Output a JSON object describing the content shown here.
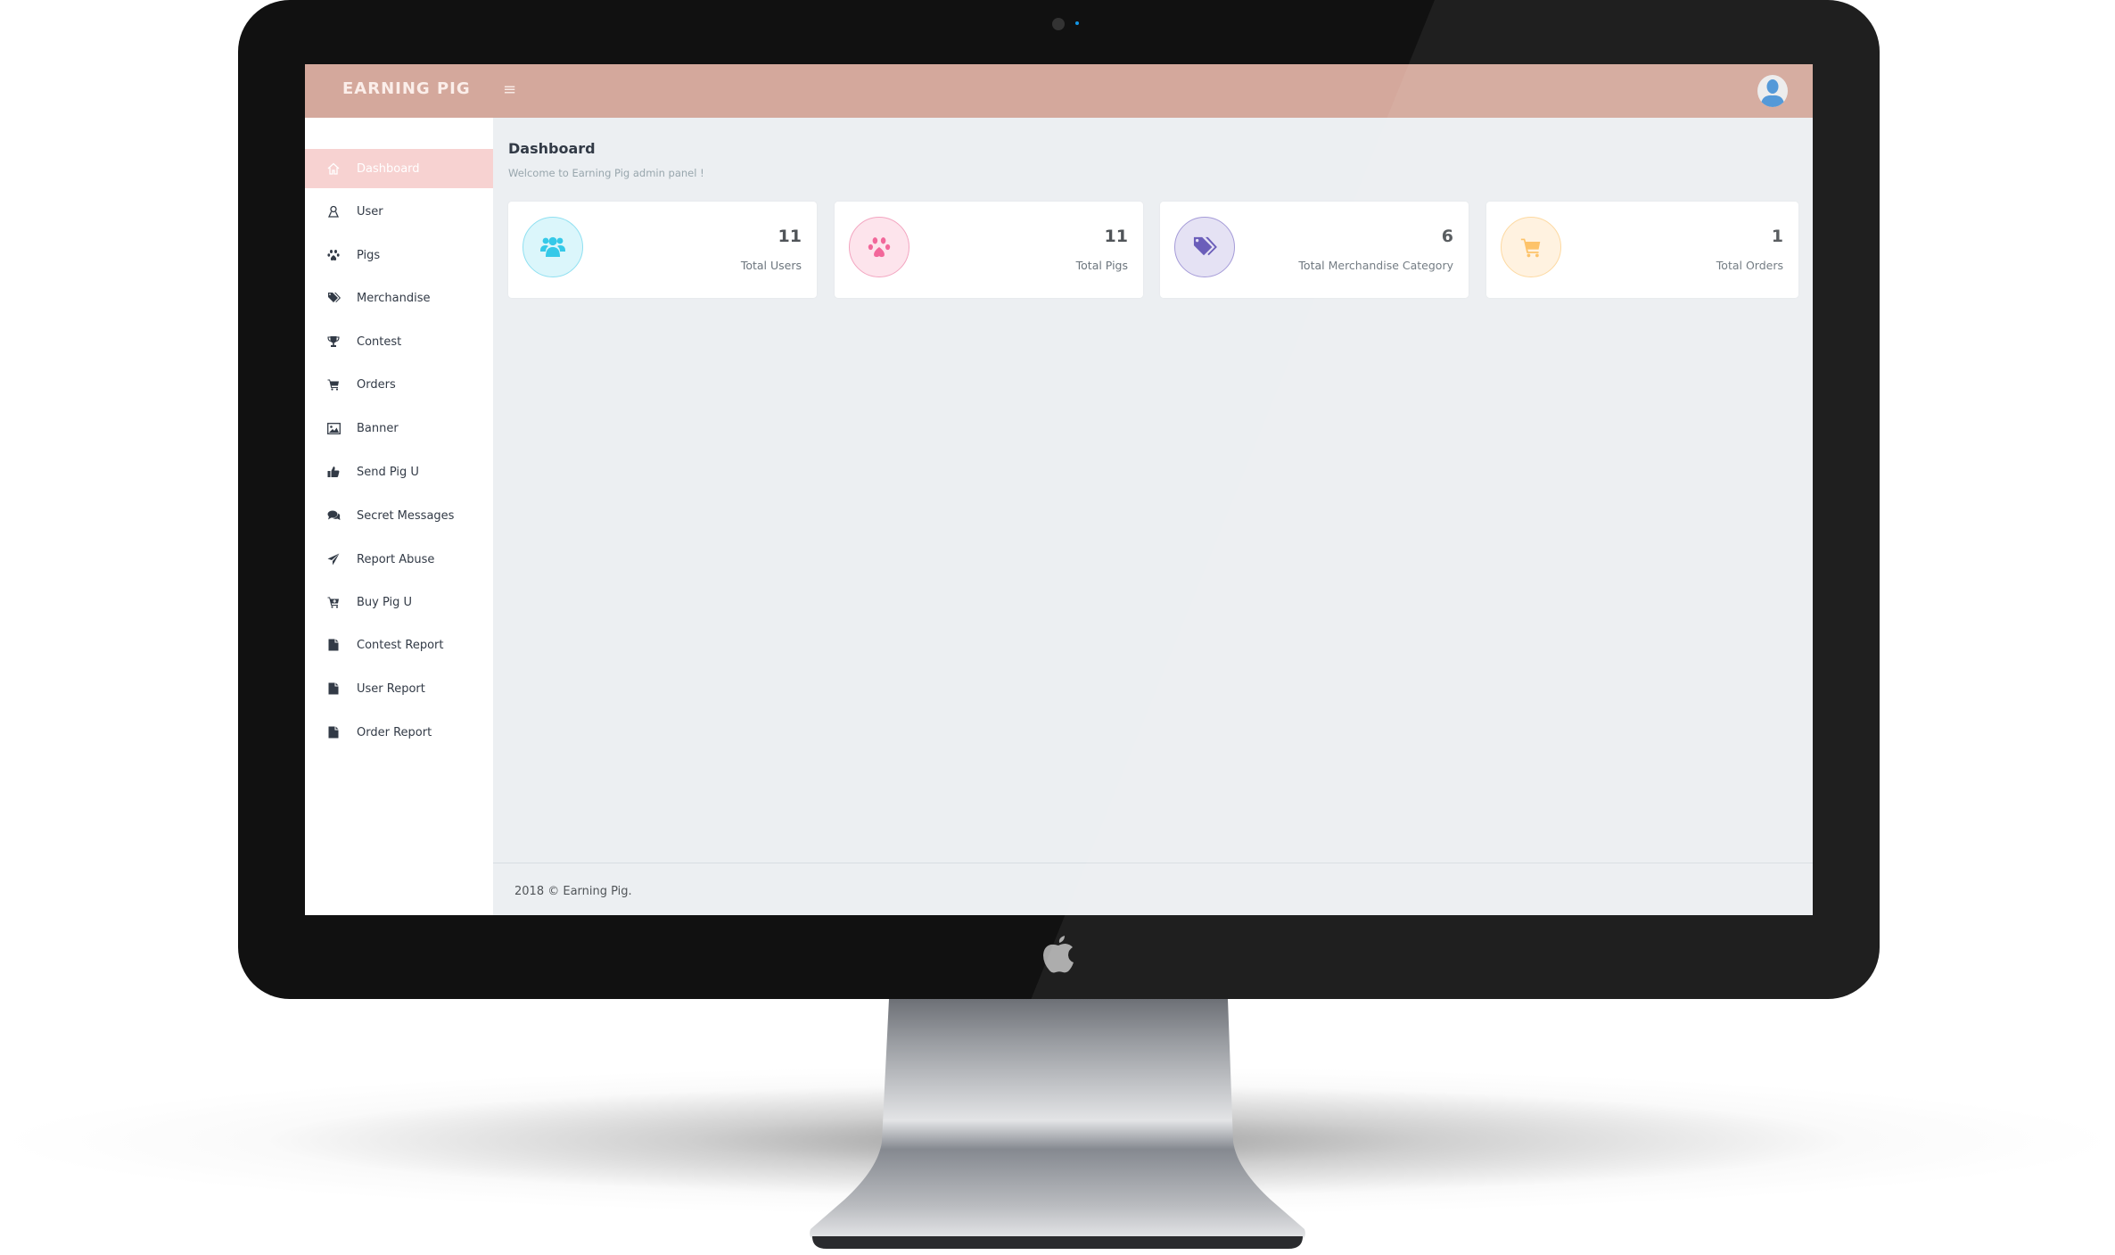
{
  "app": {
    "brand": "EARNING PIG",
    "menu_toggle": "≡"
  },
  "sidebar": {
    "items": [
      {
        "label": "Dashboard",
        "icon": "home-icon",
        "active": true
      },
      {
        "label": "User",
        "icon": "user-icon"
      },
      {
        "label": "Pigs",
        "icon": "paw-icon"
      },
      {
        "label": "Merchandise",
        "icon": "tags-icon"
      },
      {
        "label": "Contest",
        "icon": "trophy-icon"
      },
      {
        "label": "Orders",
        "icon": "cart-icon"
      },
      {
        "label": "Banner",
        "icon": "image-icon"
      },
      {
        "label": "Send Pig U",
        "icon": "thumbs-up-icon"
      },
      {
        "label": "Secret Messages",
        "icon": "comments-icon"
      },
      {
        "label": "Report Abuse",
        "icon": "paper-plane-icon"
      },
      {
        "label": "Buy Pig U",
        "icon": "cart-plus-icon"
      },
      {
        "label": "Contest Report",
        "icon": "file-icon"
      },
      {
        "label": "User Report",
        "icon": "file-icon"
      },
      {
        "label": "Order Report",
        "icon": "file-icon"
      }
    ]
  },
  "page": {
    "title": "Dashboard",
    "subtitle": "Welcome to Earning Pig admin panel !"
  },
  "stats": [
    {
      "value": "11",
      "label": "Total Users",
      "icon": "users-icon",
      "color": "#35c9e8",
      "bg": "#dbf6fb",
      "border": "#8fe0f1"
    },
    {
      "value": "11",
      "label": "Total Pigs",
      "icon": "paw-icon",
      "color": "#f2679a",
      "bg": "#fde4ec",
      "border": "#f3a5c0"
    },
    {
      "value": "6",
      "label": "Total Merchandise Category",
      "icon": "tags-icon",
      "color": "#6b5eba",
      "bg": "#e5e2f4",
      "border": "#a59bd8"
    },
    {
      "value": "1",
      "label": "Total Orders",
      "icon": "cart-icon",
      "color": "#fdc061",
      "bg": "#fff2df",
      "border": "#fdd79c"
    }
  ],
  "footer": {
    "text": "2018 © Earning Pig."
  },
  "colors": {
    "header": "#d4a89c",
    "active_nav": "#f7d2d1",
    "content_bg": "#eceff2"
  }
}
